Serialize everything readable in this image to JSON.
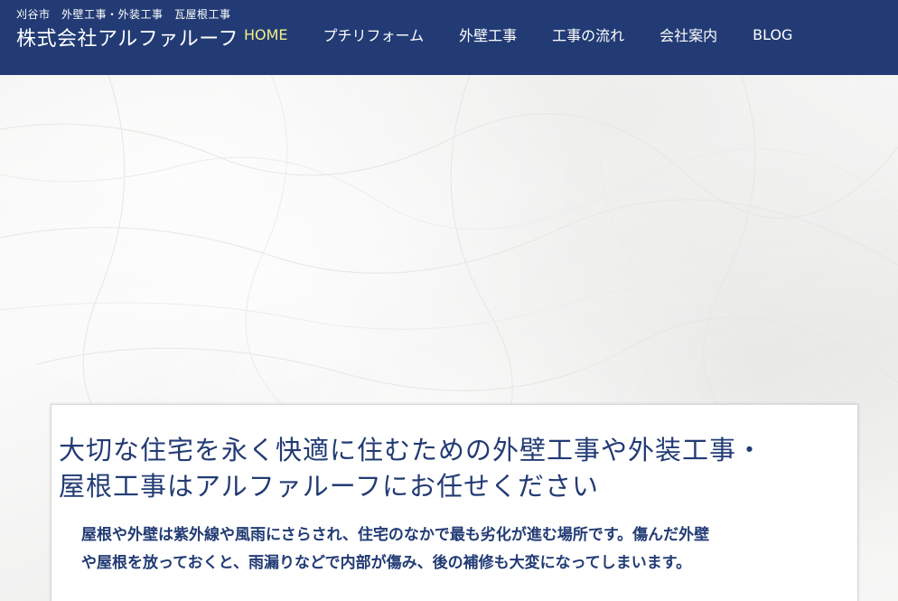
{
  "header": {
    "tagline": "刈谷市　外壁工事・外装工事　瓦屋根工事",
    "company_name": "株式会社アルファルーフ",
    "background_color": "#223b74"
  },
  "nav": {
    "items": [
      {
        "label": "HOME",
        "active": true
      },
      {
        "label": "プチリフォーム",
        "active": false
      },
      {
        "label": "外壁工事",
        "active": false
      },
      {
        "label": "工事の流れ",
        "active": false
      },
      {
        "label": "会社案内",
        "active": false
      },
      {
        "label": "BLOG",
        "active": false
      }
    ],
    "active_color": "#f4ef8a"
  },
  "intro": {
    "heading_line1": "大切な住宅を永く快適に住むための外壁工事や外装工事・",
    "heading_line2": "屋根工事はアルファルーフにお任せください",
    "text_line1": "屋根や外壁は紫外線や風雨にさらされ、住宅のなかで最も劣化が進む場所です。傷んだ外壁",
    "text_line2": "や屋根を放っておくと、雨漏りなどで内部が傷み、後の補修も大変になってしまいます。",
    "text_color": "#223b74"
  }
}
